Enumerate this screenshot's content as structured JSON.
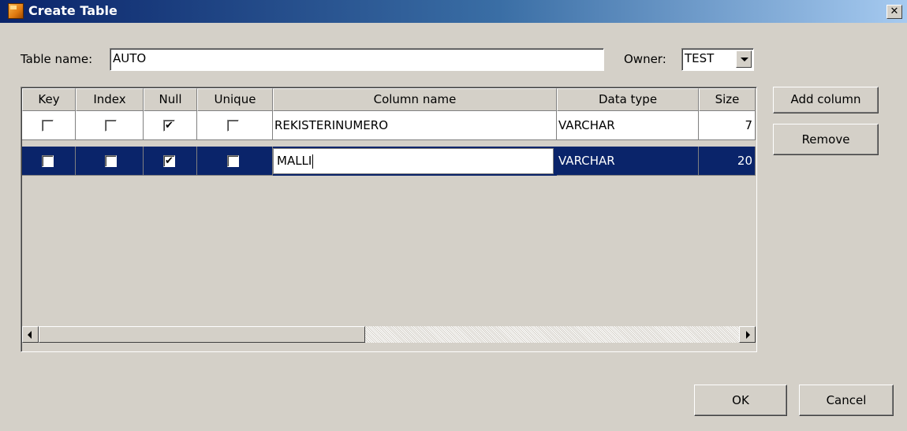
{
  "window": {
    "title": "Create Table",
    "close_glyph": "✕",
    "app_icon": "table-icon"
  },
  "form": {
    "table_name_label": "Table name:",
    "table_name_value": "AUTO",
    "owner_label": "Owner:",
    "owner_value": "TEST"
  },
  "table": {
    "headers": [
      "Key",
      "Index",
      "Null",
      "Unique",
      "Column name",
      "Data type",
      "Size"
    ],
    "rows": [
      {
        "key": false,
        "index": false,
        "null": true,
        "unique": false,
        "column_name": "REKISTERINUMERO",
        "data_type": "VARCHAR",
        "size": "7"
      },
      {
        "key": false,
        "index": false,
        "null": true,
        "unique": false,
        "column_name": "MALLI",
        "data_type": "VARCHAR",
        "size": "20"
      }
    ],
    "check_glyph": "✔"
  },
  "buttons": {
    "add_column": "Add column",
    "remove": "Remove",
    "ok": "OK",
    "cancel": "Cancel"
  },
  "colors": {
    "title_gradient_start": "#0a246a",
    "title_gradient_end": "#a6caf0",
    "selection": "#0a246a",
    "dialog_bg": "#d4d0c8"
  }
}
